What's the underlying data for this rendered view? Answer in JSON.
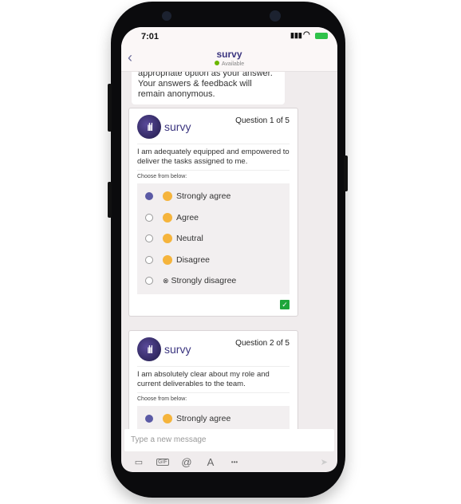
{
  "status": {
    "time": "7:01"
  },
  "header": {
    "title": "survy",
    "presence": "Available",
    "accent": "#3c3680"
  },
  "intro": {
    "text_partial": "appropriate option as your answer.",
    "text": "Your answers & feedback will remain anonymous."
  },
  "cards": [
    {
      "brand": "survy",
      "question_number": "Question 1 of 5",
      "question": "I am adequately equipped and empowered to deliver the tasks assigned to me.",
      "choose_label": "Choose from below:",
      "options": [
        {
          "label": "Strongly agree",
          "selected": true
        },
        {
          "label": "Agree",
          "selected": false
        },
        {
          "label": "Neutral",
          "selected": false
        },
        {
          "label": "Disagree",
          "selected": false
        },
        {
          "label": "Strongly disagree",
          "selected": false
        }
      ],
      "submitted_icon": "check-icon"
    },
    {
      "brand": "survy",
      "question_number": "Question 2 of 5",
      "question": "I am absolutely clear about my role and current deliverables to the team.",
      "choose_label": "Choose from below:",
      "options": [
        {
          "label": "Strongly agree",
          "selected": true
        }
      ]
    }
  ],
  "composer": {
    "placeholder": "Type a new message"
  },
  "toolbar": {
    "gif": "GIF",
    "at": "@",
    "more": "•••"
  }
}
